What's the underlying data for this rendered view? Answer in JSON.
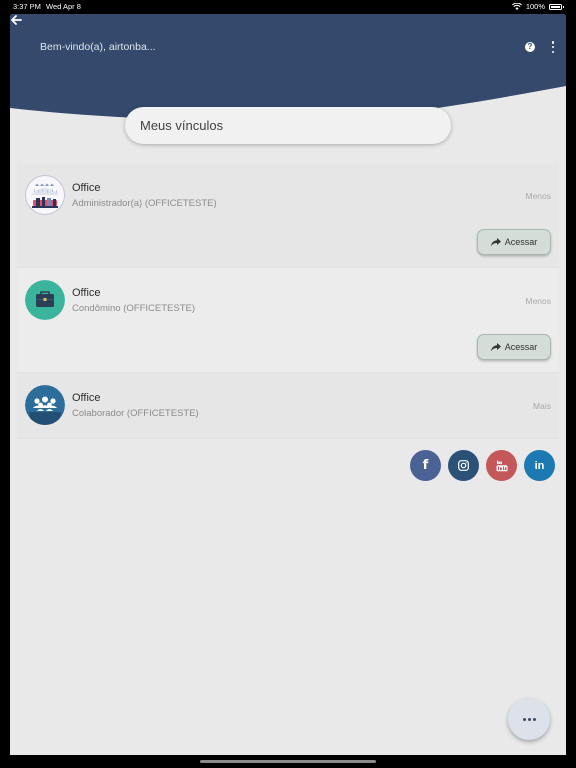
{
  "status_bar": {
    "time": "3:37 PM",
    "date": "Wed Apr 8",
    "battery": "100%",
    "battery_level": 1.0
  },
  "header": {
    "title": "Bem-vindo(a), airtonba...",
    "bg_color": "#34496b"
  },
  "section_title": "Meus vínculos",
  "links": [
    {
      "name": "Office",
      "role": "Administrador(a) (OFFICETESTE)",
      "toggle": "Menos",
      "action": "Acessar",
      "avatar_icon": "umbrella-people-icon"
    },
    {
      "name": "Office",
      "role": "Condômino (OFFICETESTE)",
      "toggle": "Menos",
      "action": "Acessar",
      "avatar_icon": "briefcase-icon"
    },
    {
      "name": "Office",
      "role": "Colaborador (OFFICETESTE)",
      "toggle": "Mais",
      "avatar_icon": "group-people-icon"
    }
  ],
  "social": {
    "facebook": {
      "label": "f",
      "color": "#4b6294"
    },
    "instagram": {
      "color": "#2b5177"
    },
    "youtube": {
      "color": "#c4575a"
    },
    "linkedin": {
      "label": "in",
      "color": "#1c79b2"
    }
  }
}
